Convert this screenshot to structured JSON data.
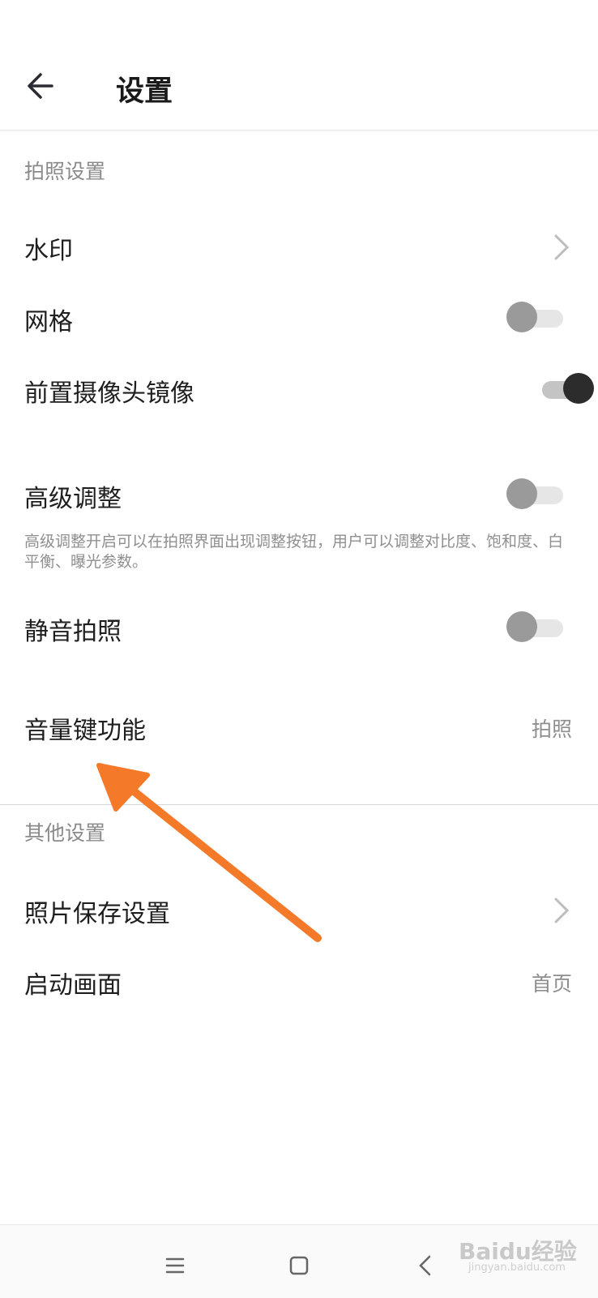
{
  "header": {
    "title": "设置",
    "back_icon": "arrow-left-icon"
  },
  "sections": [
    {
      "title": "拍照设置",
      "items": [
        {
          "label": "水印",
          "control": "chevron"
        },
        {
          "label": "网格",
          "control": "toggle",
          "on": false
        },
        {
          "label": "前置摄像头镜像",
          "control": "toggle",
          "on": true
        },
        {
          "label": "高级调整",
          "control": "toggle",
          "on": false,
          "description": "高级调整开启可以在拍照界面出现调整按钮，用户可以调整对比度、饱和度、白平衡、曝光参数。"
        },
        {
          "label": "静音拍照",
          "control": "toggle",
          "on": false
        },
        {
          "label": "音量键功能",
          "control": "value",
          "value": "拍照"
        }
      ]
    },
    {
      "title": "其他设置",
      "items": [
        {
          "label": "照片保存设置",
          "control": "chevron"
        },
        {
          "label": "启动画面",
          "control": "value",
          "value": "首页"
        }
      ]
    }
  ],
  "nav": {
    "menu_icon": "menu-icon",
    "home_icon": "home-square-icon",
    "back_icon": "back-chevron-icon"
  },
  "watermark": {
    "text": "Baidu经验",
    "sub": "jingyan.baidu.com"
  },
  "colors": {
    "annotation_arrow": "#f47a2a",
    "toggle_on_knob": "#2c2c2c",
    "toggle_off_knob": "#9a9a9a"
  }
}
